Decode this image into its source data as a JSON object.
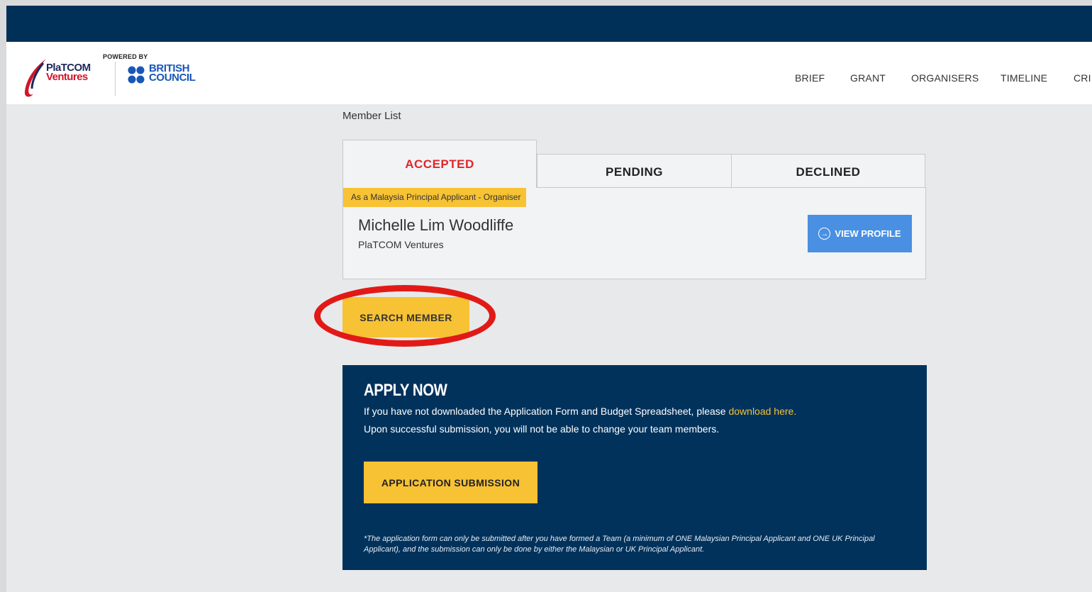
{
  "header": {
    "powered_by": "POWERED BY",
    "platcom_line1": "PlaTCOM",
    "platcom_line2": "Ventures",
    "bc_line1": "BRITISH",
    "bc_line2": "COUNCIL",
    "nav": [
      "BRIEF",
      "GRANT",
      "ORGANISERS",
      "TIMELINE",
      "CRI"
    ]
  },
  "page": {
    "title": "Member List"
  },
  "tabs": [
    {
      "label": "ACCEPTED",
      "active": true
    },
    {
      "label": "PENDING",
      "active": false
    },
    {
      "label": "DECLINED",
      "active": false
    }
  ],
  "member": {
    "role": "As a Malaysia Principal Applicant - Organiser",
    "name": "Michelle Lim Woodliffe",
    "organisation": "PlaTCOM Ventures",
    "view_profile_label": "VIEW PROFILE"
  },
  "search_member_label": "SEARCH MEMBER",
  "apply": {
    "title": "APPLY NOW",
    "line1_prefix": "If you have not downloaded the Application Form and Budget Spreadsheet, please ",
    "line1_link": "download here.",
    "line2": "Upon successful submission, you will not be able to change your team members.",
    "submit_label": "APPLICATION SUBMISSION",
    "note": "*The application form can only be submitted after you have formed a Team (a minimum of ONE Malaysian Principal Applicant and ONE UK Principal Applicant), and the submission can only be done by either the Malaysian or UK Principal Applicant."
  },
  "colors": {
    "navy": "#003058",
    "yellow": "#f7c234",
    "accepted_red": "#e0262a",
    "view_blue": "#4a90e2",
    "highlight_red": "#e11a17"
  }
}
